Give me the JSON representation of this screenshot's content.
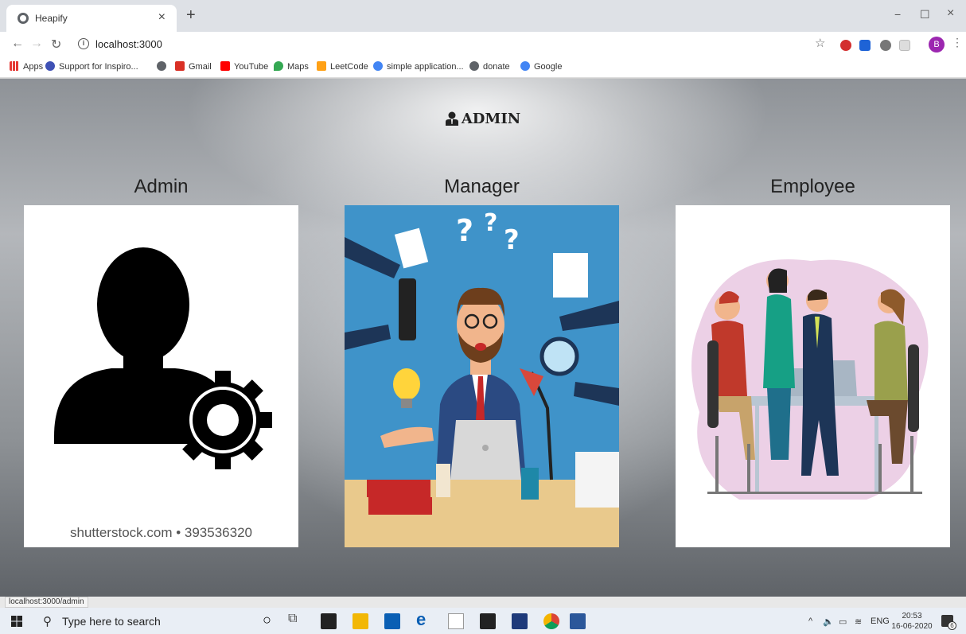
{
  "browser": {
    "tab_title": "Heapify",
    "tab_close": "×",
    "new_tab": "+",
    "url": "localhost:3000",
    "profile_initial": "B",
    "window_controls": {
      "minimize": "−",
      "maximize": "☐",
      "close": "×"
    }
  },
  "bookmarks": [
    {
      "label": "Apps",
      "icon": "apps-grid-icon",
      "color": "#e53935"
    },
    {
      "label": "Support for Inspiro...",
      "icon": "support-icon",
      "color": "#3f51b5"
    },
    {
      "label": "",
      "icon": "globe-icon",
      "color": "#5f6368"
    },
    {
      "label": "Gmail",
      "icon": "gmail-icon",
      "color": "#d93025"
    },
    {
      "label": "YouTube",
      "icon": "youtube-icon",
      "color": "#ff0000"
    },
    {
      "label": "Maps",
      "icon": "maps-pin-icon",
      "color": "#34a853"
    },
    {
      "label": "LeetCode",
      "icon": "leetcode-icon",
      "color": "#ffa116"
    },
    {
      "label": "simple application...",
      "icon": "google-icon",
      "color": "#4285f4"
    },
    {
      "label": "donate",
      "icon": "globe-icon",
      "color": "#5f6368"
    },
    {
      "label": "Google",
      "icon": "google-icon",
      "color": "#4285f4"
    }
  ],
  "page": {
    "title": "ADMIN",
    "roles": [
      {
        "label": "Admin",
        "image": "admin-gear-icon",
        "watermark": "shutterstock.com • 393536320"
      },
      {
        "label": "Manager",
        "image": "manager-illustration"
      },
      {
        "label": "Employee",
        "image": "employee-meeting-illustration"
      }
    ]
  },
  "status": {
    "hover_url": "localhost:3000/admin"
  },
  "taskbar": {
    "search_placeholder": "Type here to search",
    "tray_lang": "ENG",
    "time": "20:53",
    "date": "16-06-2020",
    "notifications": "6"
  }
}
